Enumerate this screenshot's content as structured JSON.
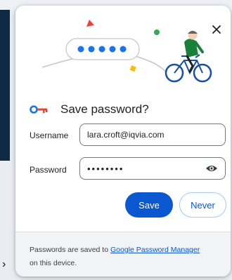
{
  "dialog": {
    "title": "Save password?",
    "close_icon": "close-icon",
    "key_icon": "key-icon",
    "illustration": "bicycle-rider-illustration"
  },
  "form": {
    "username_label": "Username",
    "username_value": "lara.croft@iqvia.com",
    "password_label": "Password",
    "password_value": "••••••••",
    "eye_icon": "eye-icon"
  },
  "actions": {
    "save_label": "Save",
    "never_label": "Never"
  },
  "footer": {
    "text_before": "Passwords are saved to ",
    "link_text": "Google Password Manager",
    "text_after": "on this device."
  },
  "colors": {
    "primary": "#0b57d0",
    "key_blue": "#1a73e8",
    "key_red": "#ea4335",
    "accent_green": "#34a853",
    "accent_yellow": "#fbbc04",
    "footer_bg": "#f1f3f4"
  }
}
